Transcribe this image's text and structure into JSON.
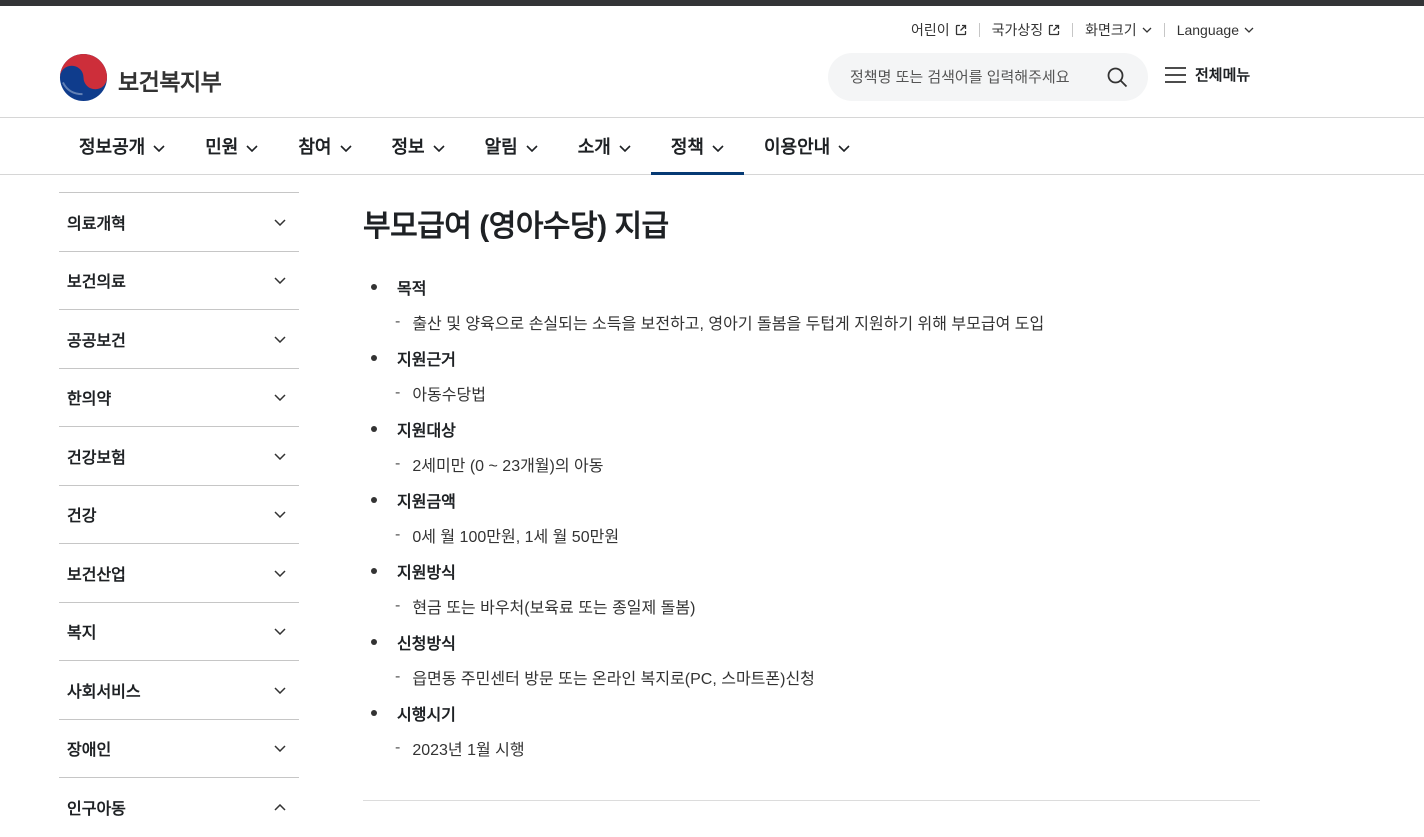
{
  "utility": {
    "kids": "어린이",
    "symbols": "국가상징",
    "text_size": "화면크기",
    "language": "Language"
  },
  "logo": {
    "name": "보건복지부"
  },
  "search": {
    "placeholder": "정책명 또는 검색어를 입력해주세요"
  },
  "all_menu": {
    "label": "전체메뉴"
  },
  "gnb": {
    "items": [
      {
        "label": "정보공개"
      },
      {
        "label": "민원"
      },
      {
        "label": "참여"
      },
      {
        "label": "정보"
      },
      {
        "label": "알림"
      },
      {
        "label": "소개"
      },
      {
        "label": "정책",
        "active": true
      },
      {
        "label": "이용안내"
      }
    ]
  },
  "side_nav": {
    "items": [
      {
        "label": "의료개혁",
        "expanded": false
      },
      {
        "label": "보건의료",
        "expanded": false
      },
      {
        "label": "공공보건",
        "expanded": false
      },
      {
        "label": "한의약",
        "expanded": false
      },
      {
        "label": "건강보험",
        "expanded": false
      },
      {
        "label": "건강",
        "expanded": false
      },
      {
        "label": "보건산업",
        "expanded": false
      },
      {
        "label": "복지",
        "expanded": false
      },
      {
        "label": "사회서비스",
        "expanded": false
      },
      {
        "label": "장애인",
        "expanded": false
      },
      {
        "label": "인구아동",
        "expanded": true
      }
    ]
  },
  "content": {
    "title": "부모급여 (영아수당) 지급",
    "sections": [
      {
        "title": "목적",
        "desc": "출산 및 양육으로 손실되는 소득을 보전하고, 영아기 돌봄을 두텁게 지원하기 위해 부모급여 도입"
      },
      {
        "title": "지원근거",
        "desc": "아동수당법"
      },
      {
        "title": "지원대상",
        "desc": "2세미만 (0 ~ 23개월)의 아동"
      },
      {
        "title": "지원금액",
        "desc": "0세 월 100만원, 1세 월 50만원"
      },
      {
        "title": "지원방식",
        "desc": "현금 또는 바우처(보육료 또는 종일제 돌봄)"
      },
      {
        "title": "신청방식",
        "desc": "읍면동 주민센터 방문 또는 온라인 복지로(PC, 스마트폰)신청"
      },
      {
        "title": "시행시기",
        "desc": "2023년 1월 시행"
      }
    ]
  },
  "colors": {
    "active_underline": "#063a74",
    "taeguk_red": "#cd2e3a",
    "taeguk_blue": "#0f3c8c",
    "search_bg": "#f4f5f6"
  }
}
